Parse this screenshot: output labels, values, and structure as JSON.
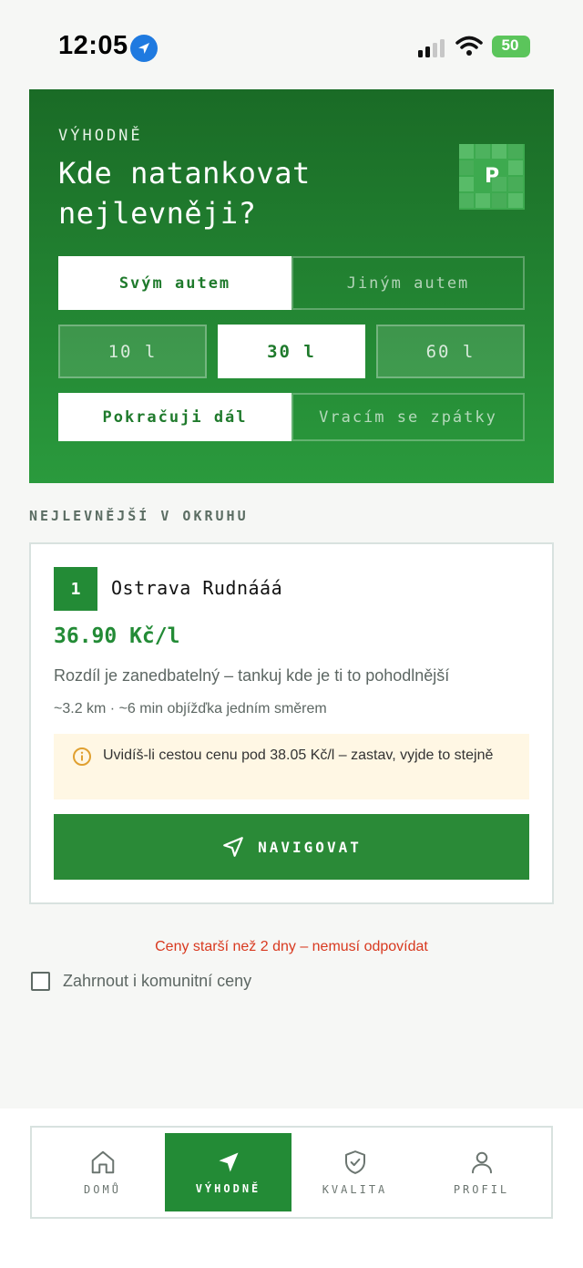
{
  "status_bar": {
    "time": "12:05",
    "battery": "50",
    "icons": [
      "location-arrow-icon",
      "cellular-signal-icon",
      "wifi-icon",
      "battery-charging-icon"
    ]
  },
  "hero": {
    "eyebrow": "VÝHODNĚ",
    "title": "Kde natankovat nejlevněji?",
    "logo_letter": "P",
    "car_options": [
      {
        "label": "Svým autem",
        "selected": true
      },
      {
        "label": "Jiným autem",
        "selected": false
      }
    ],
    "volume_options": [
      {
        "label": "10 l",
        "selected": false
      },
      {
        "label": "30 l",
        "selected": true
      },
      {
        "label": "60 l",
        "selected": false
      }
    ],
    "direction_options": [
      {
        "label": "Pokračuji dál",
        "selected": true
      },
      {
        "label": "Vracím se zpátky",
        "selected": false
      }
    ]
  },
  "section": {
    "label": "NEJLEVNĚJŠÍ V OKRUHU"
  },
  "result_card": {
    "rank": "1",
    "station_name": "Ostrava Rudnááá",
    "price": "36.90 Kč/l",
    "description": "Rozdíl je zanedbatelný – tankuj kde je ti to pohodlnější",
    "detour": "~3.2 km · ~6 min objížďka jedním směrem",
    "notice": "Uvidíš-li cestou cenu pod 38.05 Kč/l – zastav, vyjde to stejně",
    "navigate_label": "NAVIGOVAT"
  },
  "stale_warning": "Ceny starší než 2 dny – nemusí odpovídat",
  "community_checkbox": {
    "label": "Zahrnout i komunitní ceny",
    "checked": false
  },
  "bottom_nav": {
    "items": [
      {
        "label": "DOMŮ",
        "icon": "home-icon",
        "active": false
      },
      {
        "label": "VÝHODNĚ",
        "icon": "navigation-arrow-icon",
        "active": true
      },
      {
        "label": "KVALITA",
        "icon": "shield-check-icon",
        "active": false
      },
      {
        "label": "PROFIL",
        "icon": "user-icon",
        "active": false
      }
    ]
  },
  "colors": {
    "brand_green": "#238b36",
    "hero_top": "#1a6b26",
    "hero_bottom": "#2a9a3d",
    "warning_red": "#d8391f",
    "notice_bg": "#fff7e4",
    "notice_icon": "#e0a030"
  }
}
